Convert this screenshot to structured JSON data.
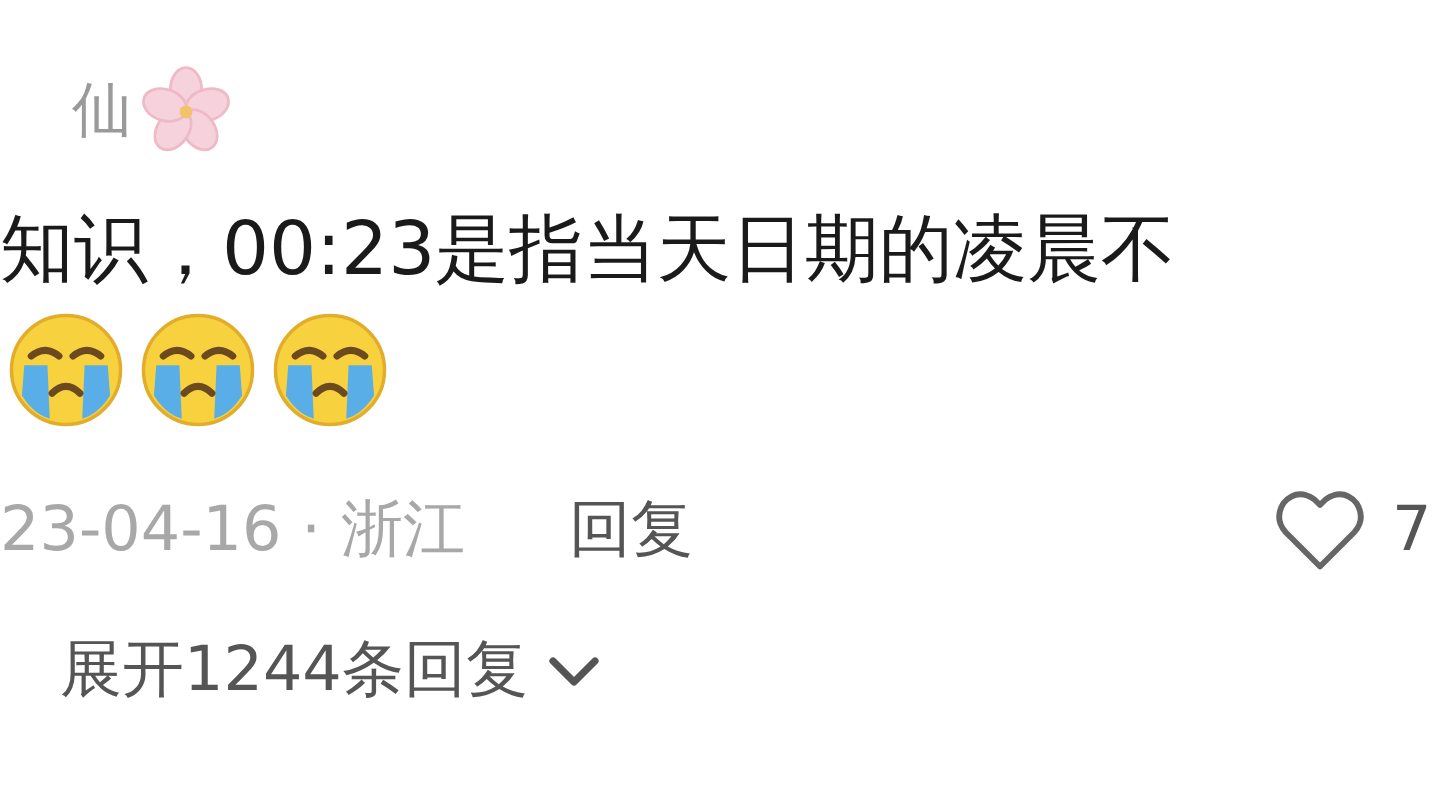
{
  "comment": {
    "username": "仙",
    "username_badge": {
      "kind": "flower"
    },
    "text": "知识，00:23是指当天日期的凌晨不",
    "emojis": [
      {
        "kind": "crying"
      },
      {
        "kind": "crying"
      },
      {
        "kind": "crying"
      }
    ],
    "date_location": "23-04-16 · 浙江",
    "reply_label": "回复",
    "like_count": "7",
    "liked": false,
    "expand_replies": "展开1244条回复"
  }
}
